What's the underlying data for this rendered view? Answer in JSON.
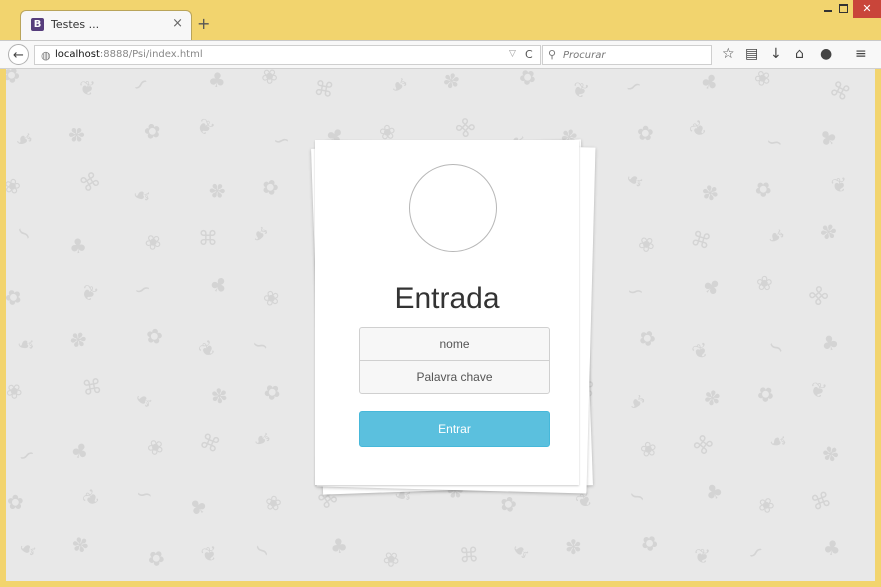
{
  "browser": {
    "tab": {
      "favicon": "B",
      "title": "Testes ...",
      "close": "×"
    },
    "new_tab": "+",
    "window_controls": {
      "close": "✕"
    },
    "url": {
      "host": "localhost",
      "rest": ":8888/Psi/index.html",
      "dropdown": "▽",
      "reload": "C"
    },
    "search": {
      "placeholder": "Procurar"
    },
    "toolbar_icons": [
      "star-icon",
      "reading-list-icon",
      "download-icon",
      "home-icon",
      "chat-icon",
      "menu-icon"
    ]
  },
  "login": {
    "title": "Entrada",
    "name_placeholder": "nome",
    "password_placeholder": "Palavra chave",
    "submit_label": "Entrar"
  },
  "colors": {
    "titlebar": "#f2d46e",
    "page_background": "#e8e8e8",
    "button": "#5bc0de",
    "close_button": "#c9453a"
  }
}
